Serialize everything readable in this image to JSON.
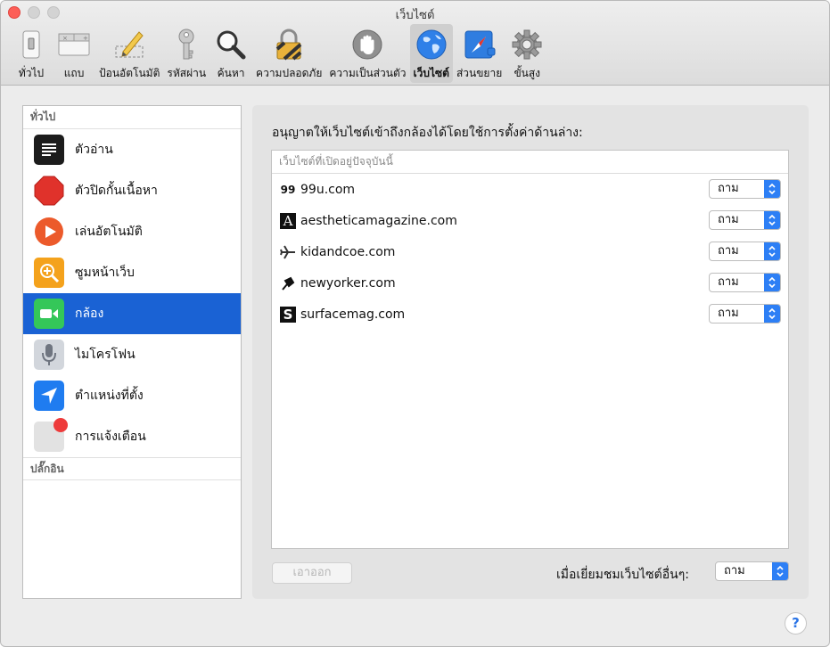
{
  "window": {
    "title": "เว็บไซต์"
  },
  "toolbar": {
    "items": [
      {
        "label": "ทั่วไป",
        "icon": "general-switch-icon"
      },
      {
        "label": "แถบ",
        "icon": "tabs-icon"
      },
      {
        "label": "ป้อนอัตโนมัติ",
        "icon": "autofill-pencil-icon"
      },
      {
        "label": "รหัสผ่าน",
        "icon": "key-icon"
      },
      {
        "label": "ค้นหา",
        "icon": "magnifier-icon"
      },
      {
        "label": "ความปลอดภัย",
        "icon": "padlock-icon"
      },
      {
        "label": "ความเป็นส่วนตัว",
        "icon": "privacy-hand-icon"
      },
      {
        "label": "เว็บไซต์",
        "icon": "globe-icon"
      },
      {
        "label": "ส่วนขยาย",
        "icon": "extensions-compass-icon"
      },
      {
        "label": "ขั้นสูง",
        "icon": "gear-icon"
      }
    ],
    "active": "เว็บไซต์"
  },
  "sidebar": {
    "general_header": "ทั่วไป",
    "items": [
      {
        "label": "ตัวอ่าน",
        "icon": "reader-icon",
        "color": "#1c1c1c"
      },
      {
        "label": "ตัวปิดกั้นเนื้อหา",
        "icon": "stop-sign-icon",
        "color": "#e0322b"
      },
      {
        "label": "เล่นอัตโนมัติ",
        "icon": "play-icon",
        "color": "#ec5a2b"
      },
      {
        "label": "ซูมหน้าเว็บ",
        "icon": "zoom-icon",
        "color": "#f4a21c"
      },
      {
        "label": "กล้อง",
        "icon": "camera-icon",
        "color": "#34c759"
      },
      {
        "label": "ไมโครโฟน",
        "icon": "microphone-icon",
        "color": "#c9ced6"
      },
      {
        "label": "ตำแหน่งที่ตั้ง",
        "icon": "location-arrow-icon",
        "color": "#1f7cf0"
      },
      {
        "label": "การแจ้งเตือน",
        "icon": "notifications-icon",
        "color": "#e2e2e2"
      }
    ],
    "selected": "กล้อง",
    "plugins_header": "ปลั๊กอิน"
  },
  "main": {
    "title": "อนุญาตให้เว็บไซต์เข้าถึงกล้องได้โดยใช้การตั้งค่าด้านล่าง:",
    "table_header": "เว็บไซต์ที่เปิดอยู่ปัจจุบันนี้",
    "sites": [
      {
        "name": "99u.com",
        "icon": "quote-99-icon",
        "setting": "ถาม"
      },
      {
        "name": "aestheticamagazine.com",
        "icon": "letter-a-icon",
        "setting": "ถาม"
      },
      {
        "name": "kidandcoe.com",
        "icon": "airplane-icon",
        "setting": "ถาม"
      },
      {
        "name": "newyorker.com",
        "icon": "newyorker-icon",
        "setting": "ถาม"
      },
      {
        "name": "surfacemag.com",
        "icon": "letter-s-icon",
        "setting": "ถาม"
      }
    ],
    "remove_label": "เอาออก",
    "other_label": "เมื่อเยี่ยมชมเว็บไซต์อื่นๆ:",
    "other_setting": "ถาม",
    "popup_arrows": "⌃⌄"
  },
  "help": {
    "label": "?"
  },
  "colors": {
    "accent": "#1a62d4",
    "popup_blue": "#2d7ff5"
  }
}
